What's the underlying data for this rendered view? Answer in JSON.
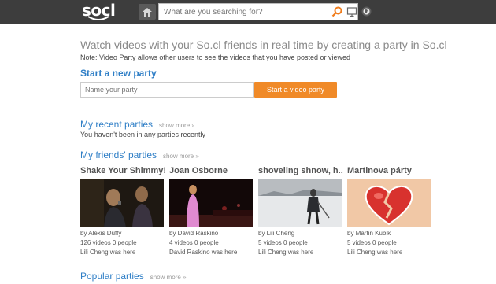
{
  "header": {
    "logo_text": "socl",
    "search_placeholder": "What are you searching for?"
  },
  "main": {
    "headline": "Watch videos with your So.cl friends in real time by creating a party in So.cl",
    "note": "Note: Video Party allows other users to see the videos that you have posted or viewed",
    "start_title": "Start a new party",
    "party_name_placeholder": "Name your party",
    "start_button": "Start a video party"
  },
  "recent": {
    "title": "My recent parties",
    "show_more": "show more ›",
    "empty": "You haven't been in any parties recently"
  },
  "friends": {
    "title": "My friends' parties",
    "show_more": "show more »",
    "cards": [
      {
        "title": "Shake Your Shimmy!",
        "by": "by Alexis Duffy",
        "stats": "126 videos 0 people",
        "here": "Lili Cheng was here"
      },
      {
        "title": "Joan Osborne",
        "by": "by David Raskino",
        "stats": "4 videos 0 people",
        "here": "David Raskino was here"
      },
      {
        "title": "shoveling shnow, h...",
        "by": "by Lili Cheng",
        "stats": "5 videos 0 people",
        "here": "Lili Cheng was here"
      },
      {
        "title": "Martinova párty",
        "by": "by Martin Kubik",
        "stats": "5 videos 0 people",
        "here": "Lili Cheng was here"
      }
    ]
  },
  "popular": {
    "title": "Popular parties",
    "show_more": "show more »"
  },
  "colors": {
    "topbar": "#3d3d3d",
    "accent_blue": "#2e7ec6",
    "button_orange": "#f08a28"
  }
}
